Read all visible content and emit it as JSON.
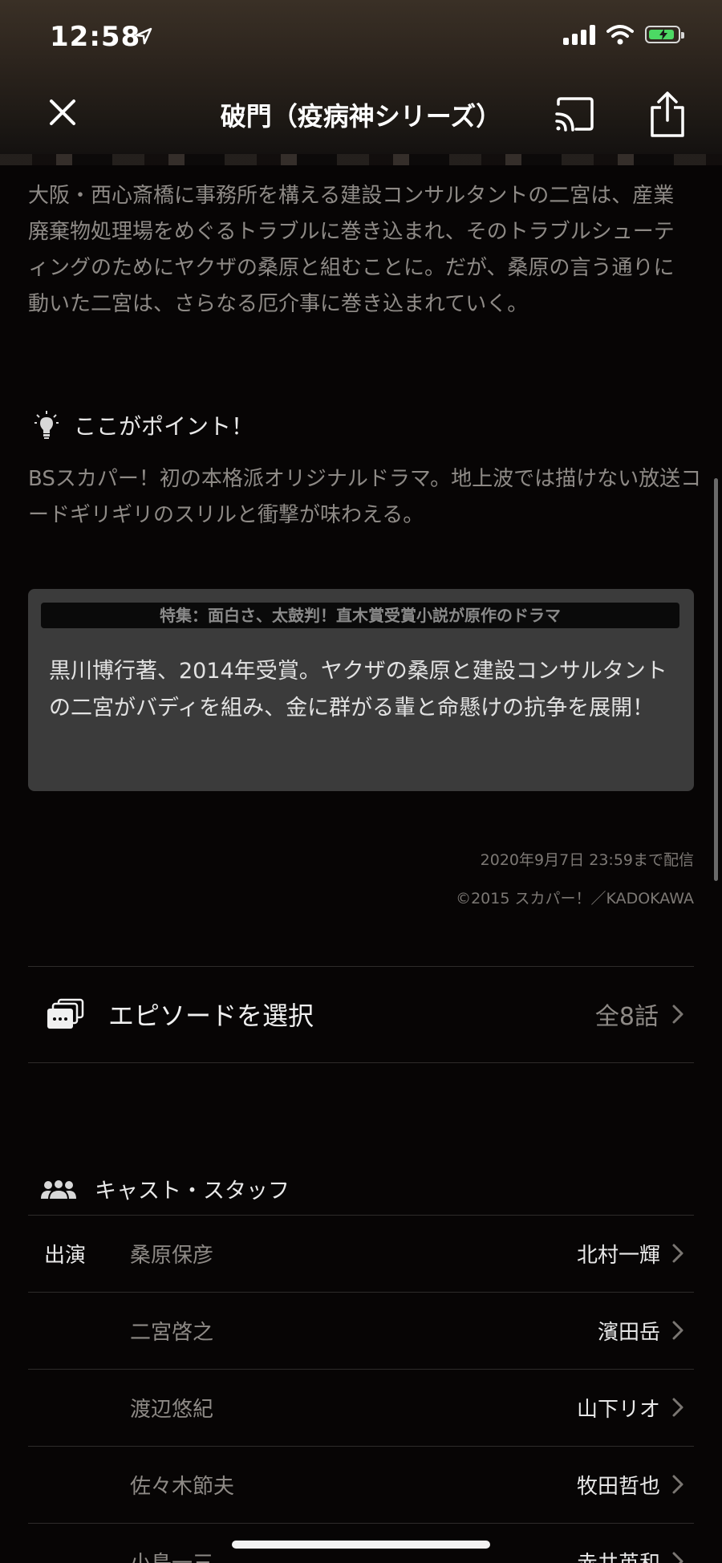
{
  "status_bar": {
    "time": "12:58"
  },
  "nav": {
    "title": "破門（疫病神シリーズ）"
  },
  "synopsis": "大阪・西心斎橋に事務所を構える建設コンサルタントの二宮は、産業廃棄物処理場をめぐるトラブルに巻き込まれ、そのトラブルシューティングのためにヤクザの桑原と組むことに。だが、桑原の言う通りに動いた二宮は、さらなる厄介事に巻き込まれていく。",
  "point": {
    "heading": "ここがポイント！",
    "text": "BSスカパー！初の本格派オリジナルドラマ。地上波では描けない放送コードギリギリのスリルと衝撃が味わえる。"
  },
  "feature": {
    "tag": "特集：面白さ、太鼓判！直木賞受賞小説が原作のドラマ",
    "body": "黒川博行著、2014年受賞。ヤクザの桑原と建設コンサルタントの二宮がバディを組み、金に群がる輩と命懸けの抗争を展開！"
  },
  "availability": "2020年9月7日 23:59まで配信",
  "copyright": "©2015 スカパー！／KADOKAWA",
  "episodes": {
    "label": "エピソードを選択",
    "count": "全8話"
  },
  "cast": {
    "heading": "キャスト・スタッフ",
    "rows": [
      {
        "type": "出演",
        "role": "桑原保彦",
        "actor": "北村一輝"
      },
      {
        "type": "",
        "role": "二宮啓之",
        "actor": "濱田岳"
      },
      {
        "type": "",
        "role": "渡辺悠紀",
        "actor": "山下リオ"
      },
      {
        "type": "",
        "role": "佐々木節夫",
        "actor": "牧田哲也"
      },
      {
        "type": "",
        "role": "小島一三",
        "actor": "赤井英和"
      }
    ]
  },
  "colors": {
    "background": "#070505",
    "card": "#3b3b3b",
    "muted_text": "#8e8a86",
    "battery": "#4cd964"
  }
}
